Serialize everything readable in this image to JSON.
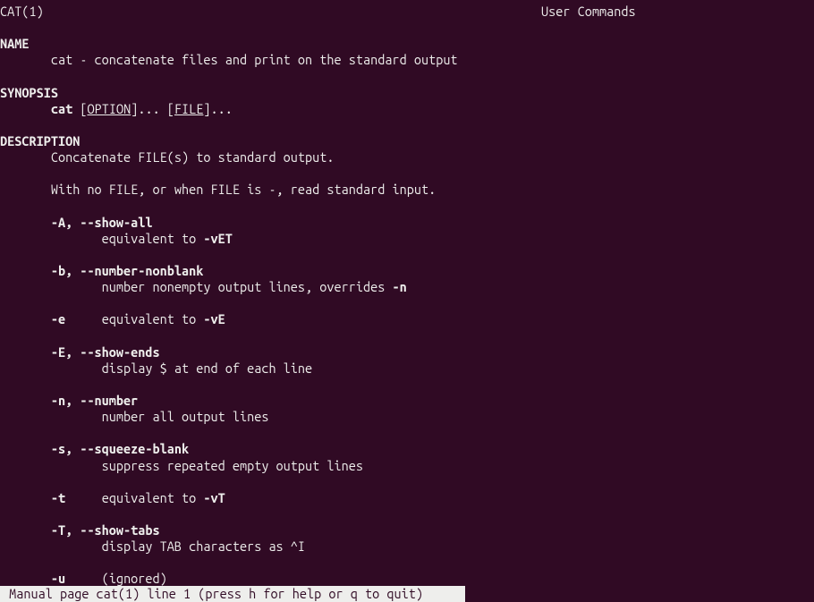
{
  "header": {
    "left": "CAT(1)",
    "right": "User Commands"
  },
  "sections": {
    "name": {
      "heading": "NAME",
      "text": "       cat - concatenate files and print on the standard output"
    },
    "synopsis": {
      "heading": "SYNOPSIS",
      "prefix": "       ",
      "cmd": "cat",
      "space1": " [",
      "arg1": "OPTION",
      "mid": "]... [",
      "arg2": "FILE",
      "end": "]..."
    },
    "description": {
      "heading": "DESCRIPTION",
      "intro1": "       Concatenate FILE(s) to standard output.",
      "intro2": "       With no FILE, or when FILE is -, read standard input.",
      "options": [
        {
          "flag": "       -A, --show-all",
          "desc_pre": "              equivalent to ",
          "desc_bold": "-vET",
          "desc_post": ""
        },
        {
          "flag": "       -b, --number-nonblank",
          "desc_pre": "              number nonempty output lines, overrides ",
          "desc_bold": "-n",
          "desc_post": ""
        },
        {
          "flag": "       -e",
          "flag_post": "     ",
          "desc_pre": "equivalent to ",
          "desc_bold": "-vE",
          "desc_post": "",
          "inline": true
        },
        {
          "flag": "       -E, --show-ends",
          "desc_pre": "              display $ at end of each line",
          "desc_bold": "",
          "desc_post": ""
        },
        {
          "flag": "       -n, --number",
          "desc_pre": "              number all output lines",
          "desc_bold": "",
          "desc_post": ""
        },
        {
          "flag": "       -s, --squeeze-blank",
          "desc_pre": "              suppress repeated empty output lines",
          "desc_bold": "",
          "desc_post": ""
        },
        {
          "flag": "       -t",
          "flag_post": "     ",
          "desc_pre": "equivalent to ",
          "desc_bold": "-vT",
          "desc_post": "",
          "inline": true
        },
        {
          "flag": "       -T, --show-tabs",
          "desc_pre": "              display TAB characters as ^I",
          "desc_bold": "",
          "desc_post": ""
        },
        {
          "flag": "       -u",
          "flag_post": "     ",
          "desc_pre": "(ignored)",
          "desc_bold": "",
          "desc_post": "",
          "inline": true
        }
      ]
    }
  },
  "statusbar": " Manual page cat(1) line 1 (press h for help or q to quit)"
}
